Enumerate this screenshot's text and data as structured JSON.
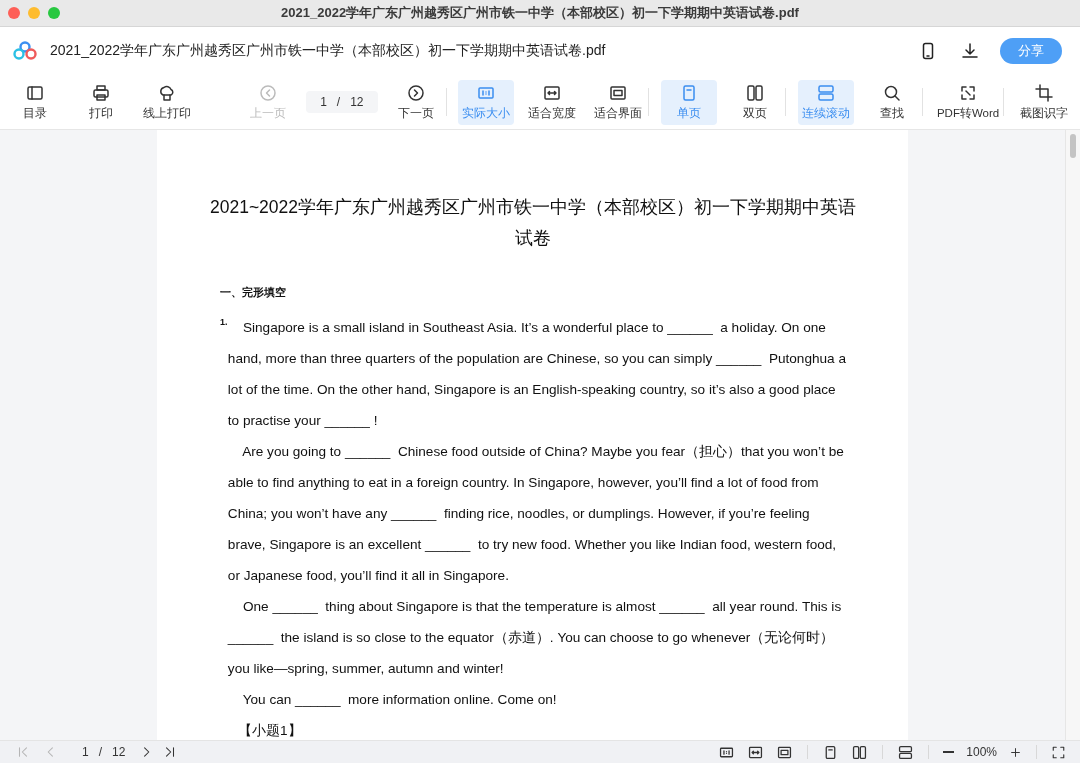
{
  "window": {
    "title": "2021_2022学年广东广州越秀区广州市铁一中学（本部校区）初一下学期期中英语试卷.pdf"
  },
  "header": {
    "file_name": "2021_2022学年广东广州越秀区广州市铁一中学（本部校区）初一下学期期中英语试卷.pdf",
    "share_label": "分享"
  },
  "toolbar": {
    "groups": [
      {
        "divider": false,
        "items": [
          {
            "kind": "toc",
            "label": "目录",
            "selected": false,
            "disabled": false
          },
          {
            "kind": "print",
            "label": "打印",
            "selected": false,
            "disabled": false
          },
          {
            "kind": "cloud",
            "label": "线上打印",
            "selected": false,
            "disabled": false
          }
        ]
      },
      {
        "divider": false,
        "items": [
          {
            "kind": "prev",
            "label": "上一页",
            "selected": false,
            "disabled": true
          },
          {
            "kind": "pager",
            "page": "1",
            "separator": "/",
            "total": "12"
          },
          {
            "kind": "next",
            "label": "下一页",
            "selected": false,
            "disabled": false
          }
        ]
      },
      {
        "divider": true,
        "items": [
          {
            "kind": "actual",
            "label": "实际大小",
            "selected": true,
            "disabled": false
          },
          {
            "kind": "fitwidth",
            "label": "适合宽度",
            "selected": false,
            "disabled": false
          },
          {
            "kind": "fitpage",
            "label": "适合界面",
            "selected": false,
            "disabled": false
          }
        ]
      },
      {
        "divider": true,
        "items": [
          {
            "kind": "single",
            "label": "单页",
            "selected": true,
            "disabled": false
          },
          {
            "kind": "double",
            "label": "双页",
            "selected": false,
            "disabled": false
          }
        ]
      },
      {
        "divider": true,
        "items": [
          {
            "kind": "scroll",
            "label": "连续滚动",
            "selected": true,
            "disabled": false
          },
          {
            "kind": "search",
            "label": "查找",
            "selected": false,
            "disabled": false
          }
        ]
      },
      {
        "divider": true,
        "items": [
          {
            "kind": "convert",
            "label": "PDF转Word",
            "selected": false,
            "disabled": false
          }
        ]
      },
      {
        "divider": true,
        "items": [
          {
            "kind": "crop",
            "label": "截图识字",
            "selected": false,
            "disabled": false
          }
        ]
      }
    ]
  },
  "document": {
    "title_lines": [
      "2021~2022学年广东广州越秀区广州市铁一中学（本部校区）初一下学期期中英语",
      "试卷"
    ],
    "section": "一、完形填空",
    "question_number": "1.",
    "paragraphs": [
      {
        "lines": [
          "Singapore is a small island in Southeast Asia. It’s a wonderful place to ______  a holiday. On one",
          "hand, more than three quarters of the population are Chinese, so you can simply ______  Putonghua a",
          "lot of the time. On the other hand, Singapore is an English-speaking country, so it’s also a good place",
          "to practise your ______ !"
        ]
      },
      {
        "lines": [
          "Are you going to ______  Chinese food outside of China? Maybe you fear（担心）that you won’t be",
          "able to find anything to eat in a foreign country. In Singapore, however, you’ll find a lot of food from",
          "China; you won’t have any ______  finding rice, noodles, or dumplings. However, if you’re feeling",
          "brave, Singapore is an excellent ______  to try new food. Whether you like Indian food, western food,",
          "or Japanese food, you’ll find it all in Singapore."
        ]
      },
      {
        "lines": [
          "One ______  thing about Singapore is that the temperature is almost ______  all year round. This is",
          "______  the island is so close to the equator（赤道）. You can choose to go whenever（无论何时）",
          "you like—spring, summer, autumn and winter!"
        ]
      },
      {
        "lines": [
          "You can ______  more information online. Come on!"
        ]
      }
    ],
    "subquestion": "【小题1】"
  },
  "status_bar": {
    "page": "1",
    "separator": "/",
    "total": "12",
    "zoom": "100%"
  }
}
